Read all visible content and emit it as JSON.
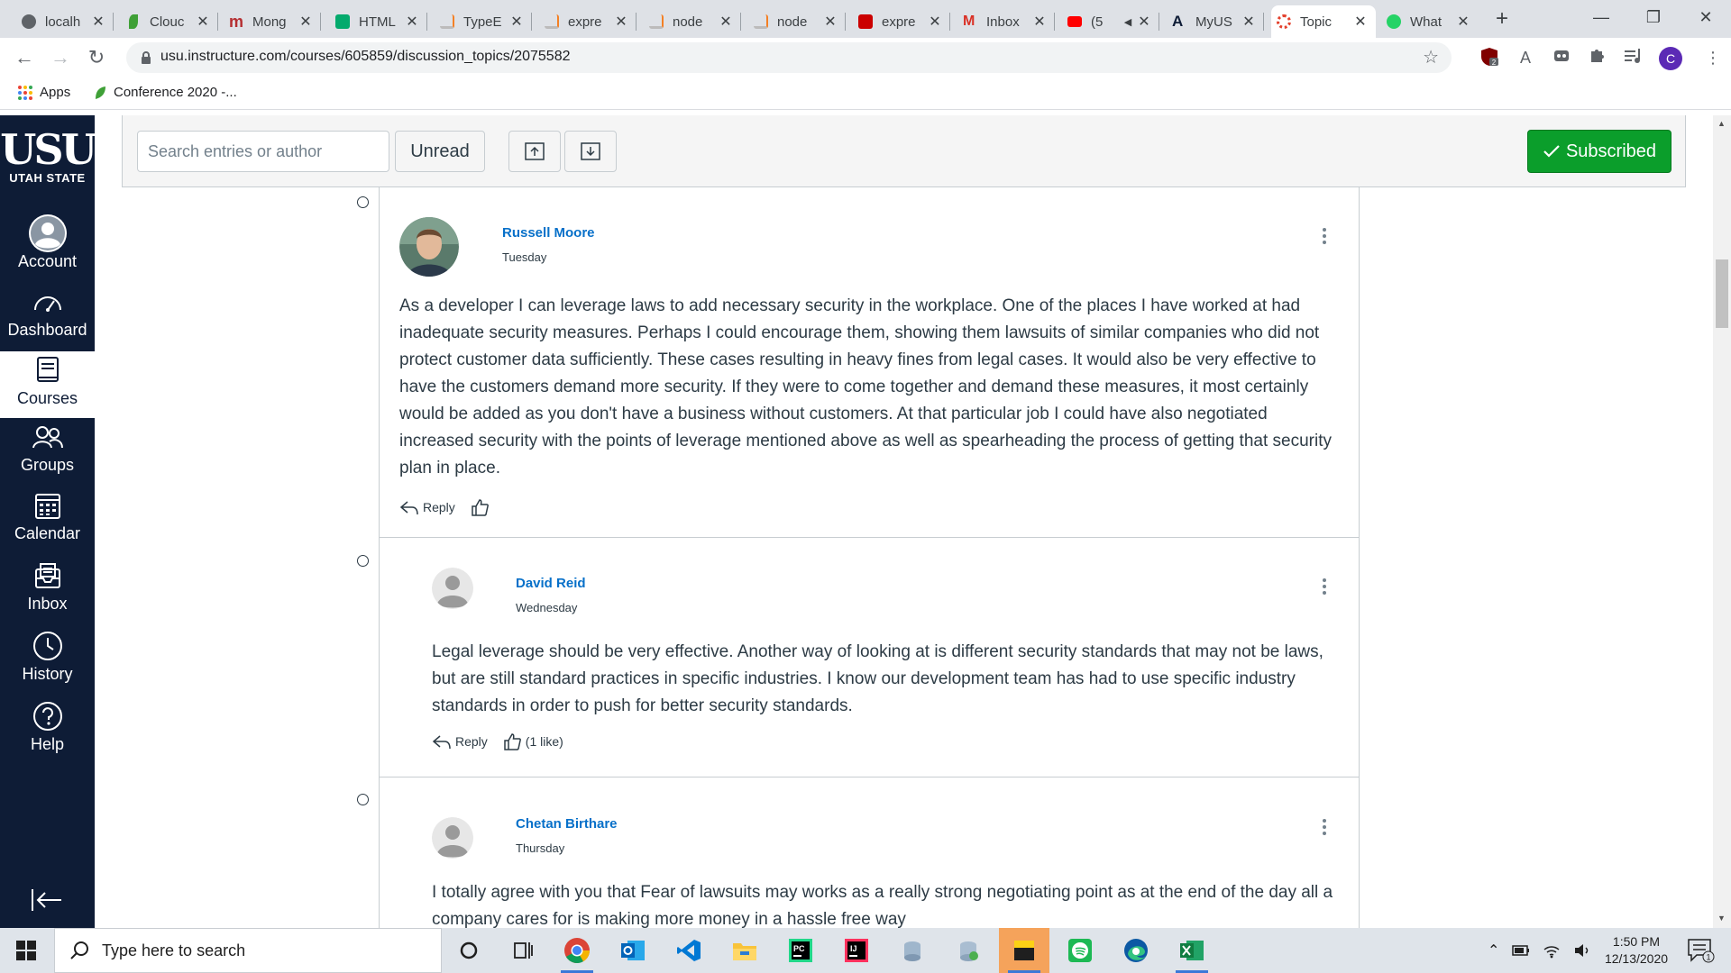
{
  "browser": {
    "tabs": [
      {
        "label": "localh",
        "icon": "globe-icon",
        "color": "#5f6368"
      },
      {
        "label": "Clouc",
        "icon": "leaf-icon",
        "color": "#3fa037"
      },
      {
        "label": "Mong",
        "icon": "m-icon",
        "color": "#b52e31"
      },
      {
        "label": "HTML",
        "icon": "w3-icon",
        "color": "#04aa6d"
      },
      {
        "label": "TypeE",
        "icon": "stackoverflow-icon",
        "color": "#f48024"
      },
      {
        "label": "expre",
        "icon": "stackoverflow-icon",
        "color": "#f48024"
      },
      {
        "label": "node",
        "icon": "stackoverflow-icon",
        "color": "#f48024"
      },
      {
        "label": "node",
        "icon": "stackoverflow-icon",
        "color": "#f48024"
      },
      {
        "label": "expre",
        "icon": "npm-icon",
        "color": "#cb0000"
      },
      {
        "label": "Inbox",
        "icon": "gmail-icon",
        "color": "#d93025"
      },
      {
        "label": "(5",
        "icon": "youtube-icon",
        "color": "#ff0000"
      },
      {
        "label": "MyUS",
        "icon": "usu-a-icon",
        "color": "#0e1c36"
      },
      {
        "label": "Topic",
        "icon": "canvas-icon",
        "color": "#e4412d",
        "active": true
      },
      {
        "label": "What",
        "icon": "whatsapp-icon",
        "color": "#25d366"
      }
    ],
    "url": "usu.instructure.com/courses/605859/discussion_topics/2075582",
    "profile_initial": "C",
    "extension_badge": "2",
    "bookmarks": [
      {
        "label": "Apps",
        "icon": "apps-grid-icon"
      },
      {
        "label": "Conference 2020 -...",
        "icon": "leaf-icon"
      }
    ]
  },
  "globalnav": {
    "logo_mark": "USU",
    "logo_sub": "UTAH STATE",
    "items": [
      {
        "label": "Account",
        "icon": "account-icon"
      },
      {
        "label": "Dashboard",
        "icon": "dashboard-icon"
      },
      {
        "label": "Courses",
        "icon": "courses-icon",
        "active": true
      },
      {
        "label": "Groups",
        "icon": "groups-icon"
      },
      {
        "label": "Calendar",
        "icon": "calendar-icon"
      },
      {
        "label": "Inbox",
        "icon": "inbox-icon"
      },
      {
        "label": "History",
        "icon": "history-icon"
      },
      {
        "label": "Help",
        "icon": "help-icon"
      }
    ]
  },
  "discussion_bar": {
    "search_placeholder": "Search entries or author",
    "unread_label": "Unread",
    "subscribed_label": "Subscribed",
    "subscribed_color": "#0b9e2b"
  },
  "entries": [
    {
      "author": "Russell Moore",
      "when": "Tuesday",
      "avatar": "photo",
      "body": "As a developer I can leverage laws to add necessary security in the workplace. One of the places I have worked at had inadequate security measures. Perhaps I could encourage them, showing them lawsuits of similar companies who did not protect customer data sufficiently. These cases resulting in heavy fines from legal cases. It would also be very effective to have the customers demand more security. If they were to come together and demand these measures, it most certainly would be added as you don't have a business without customers. At that particular job I could have also negotiated increased security with the points of leverage mentioned above as well as spearheading the process of getting that security plan in place.",
      "reply_label": "Reply",
      "likes": ""
    },
    {
      "author": "David Reid",
      "when": "Wednesday",
      "avatar": "default",
      "body": "Legal leverage should be very effective. Another way of looking at is different security standards that may not be laws, but are still standard practices in specific industries. I know our development team has had to use specific industry standards in order to push for better security standards.",
      "reply_label": "Reply",
      "likes": "(1 like)"
    },
    {
      "author": "Chetan Birthare",
      "when": "Thursday",
      "avatar": "default",
      "body": "I totally agree with you that Fear of lawsuits may works as a really strong negotiating point as at the end of the day all a company cares for is making more money in a hassle free way",
      "reply_label": "",
      "likes": ""
    }
  ],
  "taskbar": {
    "search_placeholder": "Type here to search",
    "apps": [
      "cortana-icon",
      "task-view-icon",
      "chrome-icon",
      "outlook-icon",
      "vscode-icon",
      "file-explorer-icon",
      "pycharm-icon",
      "intellij-icon",
      "disk-icon",
      "disk-sync-icon",
      "sticky-notes-icon",
      "spotify-icon",
      "edge-icon",
      "excel-icon"
    ],
    "time": "1:50 PM",
    "date": "12/13/2020",
    "notification_count": "1"
  }
}
